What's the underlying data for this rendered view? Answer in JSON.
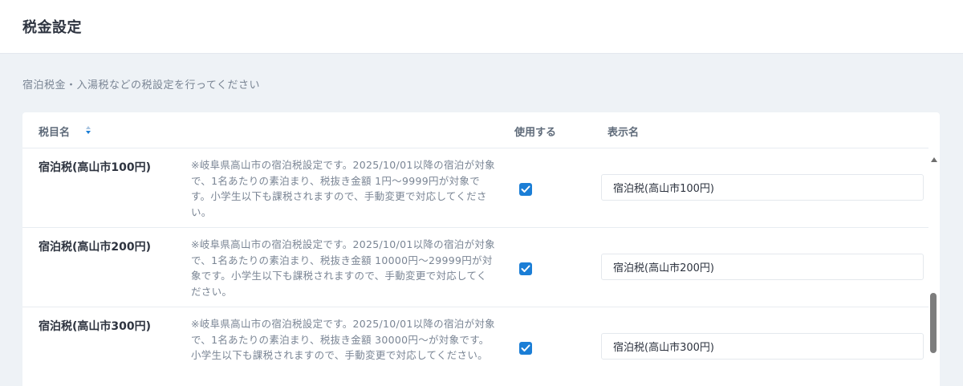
{
  "header": {
    "title": "税金設定"
  },
  "description": "宿泊税金・入湯税などの税設定を行ってください",
  "table": {
    "columns": {
      "name": "税目名",
      "use": "使用する",
      "display": "表示名"
    },
    "rows": [
      {
        "name": "宿泊税(高山市100円)",
        "note": "※岐阜県高山市の宿泊税設定です。2025/10/01以降の宿泊が対象で、1名あたりの素泊まり、税抜き金額 1円～9999円が対象です。小学生以下も課税されますので、手動変更で対応してください。",
        "use": true,
        "display_value": "宿泊税(高山市100円)"
      },
      {
        "name": "宿泊税(高山市200円)",
        "note": "※岐阜県高山市の宿泊税設定です。2025/10/01以降の宿泊が対象で、1名あたりの素泊まり、税抜き金額 10000円～29999円が対象です。小学生以下も課税されますので、手動変更で対応してください。",
        "use": true,
        "display_value": "宿泊税(高山市200円)"
      },
      {
        "name": "宿泊税(高山市300円)",
        "note": "※岐阜県高山市の宿泊税設定です。2025/10/01以降の宿泊が対象で、1名あたりの素泊まり、税抜き金額 30000円～が対象です。小学生以下も課税されますので、手動変更で対応してください。",
        "use": true,
        "display_value": "宿泊税(高山市300円)"
      }
    ]
  },
  "icons": {
    "sort": "sort-icon",
    "check": "check-icon",
    "scroll_up": "scroll-up-arrow-icon"
  },
  "colors": {
    "accent": "#1b7ed6",
    "background": "#eef2f6",
    "muted_text": "#7a8594"
  }
}
